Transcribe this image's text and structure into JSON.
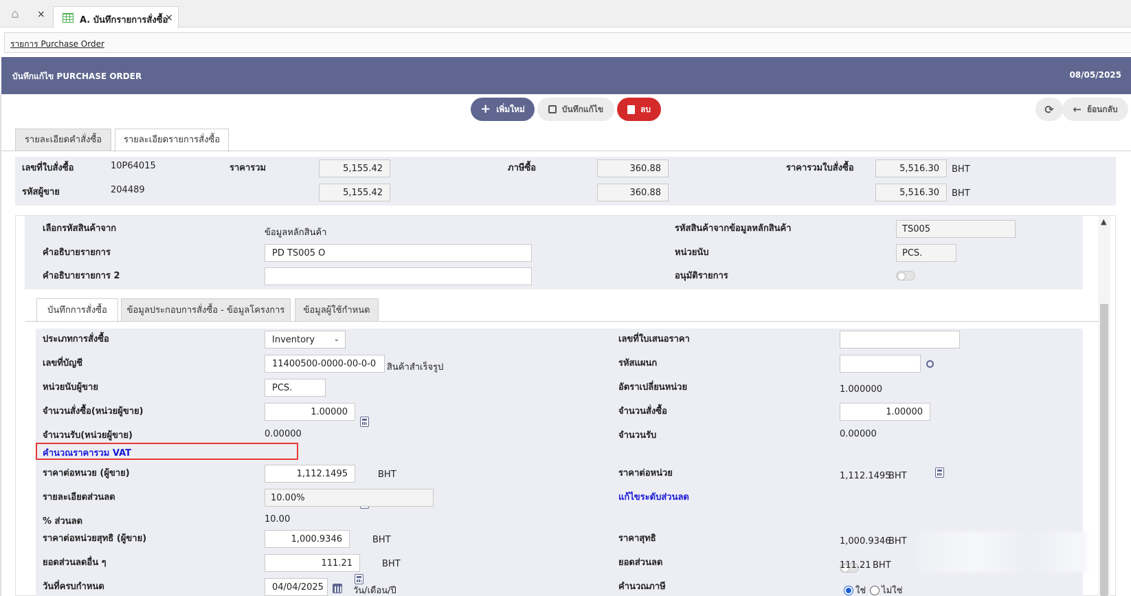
{
  "tabs": {
    "home_close": "×",
    "doc_tab_label": "A. บันทึกรายการสั่งซื้อ",
    "doc_tab_close": "×"
  },
  "breadcrumb": "รายการ Purchase Order",
  "header": {
    "title": "บันทึกแก้ไข PURCHASE ORDER",
    "date": "08/05/2025"
  },
  "toolbar": {
    "add": "เพิ่มใหม่",
    "save": "บันทึกแก้ไข",
    "delete": "ลบ",
    "back": "ย้อนกลับ"
  },
  "main_tabs": [
    "รายละเอียดคำสั่งซื้อ",
    "รายละเอียดรายการสั่งซื้อ"
  ],
  "summary": {
    "po_no_label": "เลขที่ใบสั่งซื้อ",
    "po_no": "10P64015",
    "vendor_label": "รหัสผู้ขาย",
    "vendor": "204489",
    "total_label": "ราคารวม",
    "total_1": "5,155.42",
    "total_2": "5,155.42",
    "tax_label": "ภาษีซื้อ",
    "tax_1": "360.88",
    "tax_2": "360.88",
    "grand_label": "ราคารวมใบสั่งซื้อ",
    "grand_1": "5,516.30",
    "grand_2": "5,516.30",
    "currency": "BHT"
  },
  "item": {
    "source_label": "เลือกรหัสสินค้าจาก",
    "source_value": "ข้อมูลหลักสินค้า",
    "desc_label": "คำอธิบายรายการ",
    "desc_value": "PD TS005  O",
    "desc2_label": "คำอธิบายรายการ 2",
    "desc2_value": "",
    "code_label": "รหัสสินค้าจากข้อมูลหลักสินค้า",
    "code_value": "TS005",
    "unit_label": "หน่วยนับ",
    "unit_value": "PCS.",
    "approve_label": "อนุมัติรายการ"
  },
  "sub_tabs": [
    "บันทึกการสั่งซื้อ",
    "ข้อมูลประกอบการสั่งซื้อ - ข้อมูลโครงการ",
    "ข้อมูลผู้ใช้กำหนด"
  ],
  "order": {
    "type_label": "ประเภทการสั่งซื้อ",
    "type_value": "Inventory",
    "account_label": "เลขที่บัญชี",
    "account_value": "11400500-0000-00-0-0",
    "account_desc": "สินค้าสำเร็จรูป",
    "vendor_unit_label": "หน่วยนับผู้ขาย",
    "vendor_unit_value": "PCS.",
    "qty_vendor_label": "จำนวนสั่งซื้อ(หน่วยผู้ขาย)",
    "qty_vendor_value": "1.00000",
    "recv_vendor_label": "จำนวนรับ(หน่วยผู้ขาย)",
    "recv_vendor_value": "0.00000",
    "vat_calc_label": "คำนวณราคารวม VAT",
    "unit_price_vendor_label": "ราคาต่อหนวย (ผู้ขาย)",
    "unit_price_vendor_value": "1,112.1495",
    "discount_detail_label": "รายละเอียดส่วนลด",
    "discount_detail_value": "10.00%",
    "discount_pct_label": "% ส่วนลด",
    "discount_pct_value": "10.00",
    "net_unit_vendor_label": "ราคาต่อหน่วยสุทธิ (ผู้ขาย)",
    "net_unit_vendor_value": "1,000.9346",
    "other_discount_label": "ยอดส่วนลดอื่น ๆ",
    "other_discount_value": "111.21",
    "due_date_label": "วันที่ครบกำหนด",
    "due_date_value": "04/04/2025",
    "date_format": "วัน/เดือน/ปี",
    "quote_label": "เลขที่ใบเสนอราคา",
    "quote_value": "",
    "dept_label": "รหัสแผนก",
    "dept_value": "",
    "conv_label": "อัตราเปลี่ยนหน่วย",
    "conv_value": "1.000000",
    "qty_label": "จำนวนสั่งซื้อ",
    "qty_value": "1.00000",
    "recv_label": "จำนวนรับ",
    "recv_value": "0.00000",
    "unit_price_label": "ราคาต่อหน่วย",
    "unit_price_value": "1,112.1495",
    "edit_discount_label": "แก้ไขระดับส่วนลด",
    "net_price_label": "ราคาสุทธิ",
    "net_price_value": "1,000.9346",
    "discount_amt_label": "ยอดส่วนลด",
    "discount_amt_value": "111.21",
    "tax_calc_label": "คำนวณภาษี",
    "yes": "ใช่",
    "no": "ไม่ใช่",
    "currency": "BHT"
  },
  "colors": {
    "header": "#5f668f",
    "delete": "#d42a2a",
    "highlight": "#e53935",
    "link_label": "#1a1ad6"
  }
}
